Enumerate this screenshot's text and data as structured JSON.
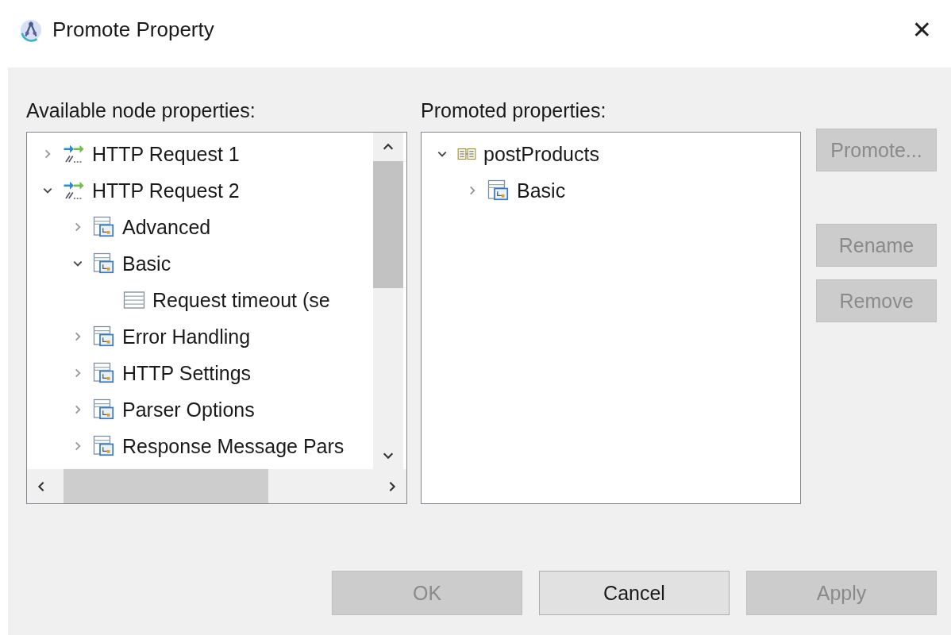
{
  "window": {
    "title": "Promote Property",
    "close": "✕"
  },
  "available": {
    "label": "Available node properties:",
    "tree": [
      {
        "kind": "flow",
        "label": "HTTP Request 1",
        "expanded": false
      },
      {
        "kind": "flow",
        "label": "HTTP Request 2",
        "expanded": true,
        "children": [
          {
            "kind": "group",
            "label": "Advanced",
            "expanded": false
          },
          {
            "kind": "group",
            "label": "Basic",
            "expanded": true,
            "children": [
              {
                "kind": "property",
                "label": "Request timeout (se"
              }
            ]
          },
          {
            "kind": "group",
            "label": "Error Handling",
            "expanded": false
          },
          {
            "kind": "group",
            "label": "HTTP Settings",
            "expanded": false
          },
          {
            "kind": "group",
            "label": "Parser Options",
            "expanded": false
          },
          {
            "kind": "group",
            "label": "Response Message Pars",
            "expanded": false
          }
        ]
      }
    ]
  },
  "promoted": {
    "label": "Promoted properties:",
    "tree": [
      {
        "kind": "operation",
        "label": "postProducts",
        "expanded": true,
        "children": [
          {
            "kind": "group",
            "label": "Basic",
            "expanded": false
          }
        ]
      }
    ]
  },
  "side_buttons": [
    {
      "label": "Promote...",
      "disabled": true
    },
    {
      "label": "Rename",
      "disabled": true
    },
    {
      "label": "Remove",
      "disabled": true
    }
  ],
  "buttons": [
    {
      "label": "OK",
      "disabled": true
    },
    {
      "label": "Cancel",
      "disabled": false
    },
    {
      "label": "Apply",
      "disabled": true
    }
  ]
}
